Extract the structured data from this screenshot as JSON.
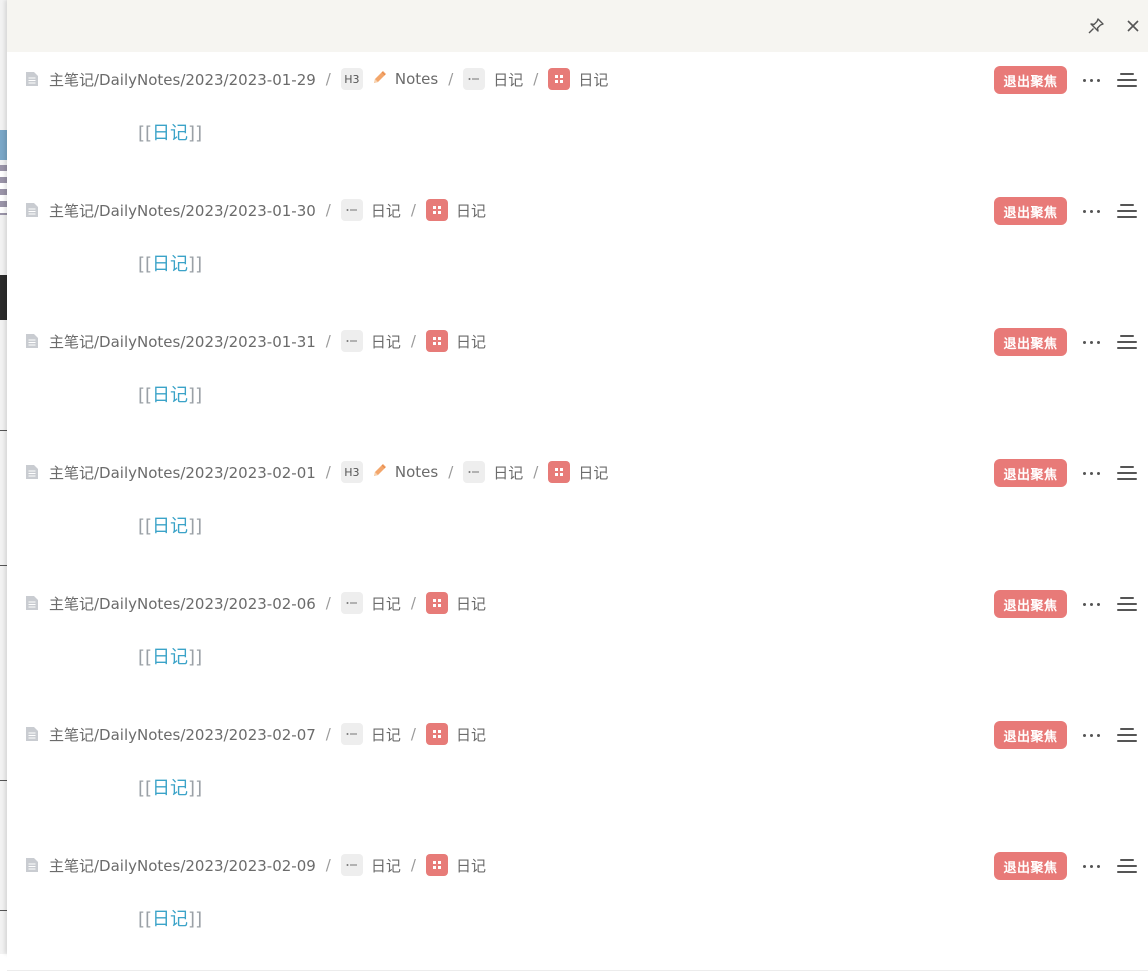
{
  "topbar": {
    "pin_icon": "pin-icon",
    "close_icon": "close-icon"
  },
  "exit_label": "退出聚焦",
  "bracket_open": "[[",
  "bracket_close": "]]",
  "entries": [
    {
      "path": "主笔记/DailyNotes/2023/2023-01-29",
      "has_notes": true,
      "notes_label": "Notes",
      "h3_label": "H3",
      "list_label": "日记",
      "db_label": "日记",
      "link_text": "日记"
    },
    {
      "path": "主笔记/DailyNotes/2023/2023-01-30",
      "has_notes": false,
      "list_label": "日记",
      "db_label": "日记",
      "link_text": "日记"
    },
    {
      "path": "主笔记/DailyNotes/2023/2023-01-31",
      "has_notes": false,
      "list_label": "日记",
      "db_label": "日记",
      "link_text": "日记"
    },
    {
      "path": "主笔记/DailyNotes/2023/2023-02-01",
      "has_notes": true,
      "notes_label": "Notes",
      "h3_label": "H3",
      "list_label": "日记",
      "db_label": "日记",
      "link_text": "日记"
    },
    {
      "path": "主笔记/DailyNotes/2023/2023-02-06",
      "has_notes": false,
      "list_label": "日记",
      "db_label": "日记",
      "link_text": "日记"
    },
    {
      "path": "主笔记/DailyNotes/2023/2023-02-07",
      "has_notes": false,
      "list_label": "日记",
      "db_label": "日记",
      "link_text": "日记"
    },
    {
      "path": "主笔记/DailyNotes/2023/2023-02-09",
      "has_notes": false,
      "list_label": "日记",
      "db_label": "日记",
      "link_text": "日记"
    }
  ]
}
